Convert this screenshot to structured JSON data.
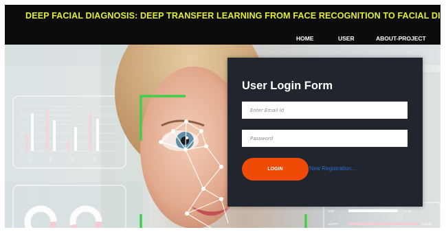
{
  "header": {
    "title": "DEEP FACIAL DIAGNOSIS: DEEP TRANSFER LEARNING FROM FACE RECOGNITION TO FACIAL DIAGNOSIS",
    "nav": [
      {
        "label": "HOME"
      },
      {
        "label": "USER"
      },
      {
        "label": "ABOUT-PROJECT"
      }
    ]
  },
  "hero": {
    "chart_ticks": [
      "1",
      "2",
      "3",
      "4"
    ],
    "hud_rows": [
      {
        "label": "SAD",
        "value": "17.38"
      },
      {
        "label": "HAPPY",
        "value": "148.36"
      }
    ]
  },
  "login": {
    "title": "User Login Form",
    "email_placeholder": "Enter Email Id",
    "email_value": "",
    "password_placeholder": "Password",
    "password_value": "",
    "login_label": "LOGIN",
    "register_link": "New Registration..."
  },
  "colors": {
    "title_yellow": "#e4ee2a",
    "card_bg": "#21252e",
    "button_orange": "#f04a07",
    "link_blue": "#2b6ed2",
    "scan_green": "#3ecf4c"
  }
}
